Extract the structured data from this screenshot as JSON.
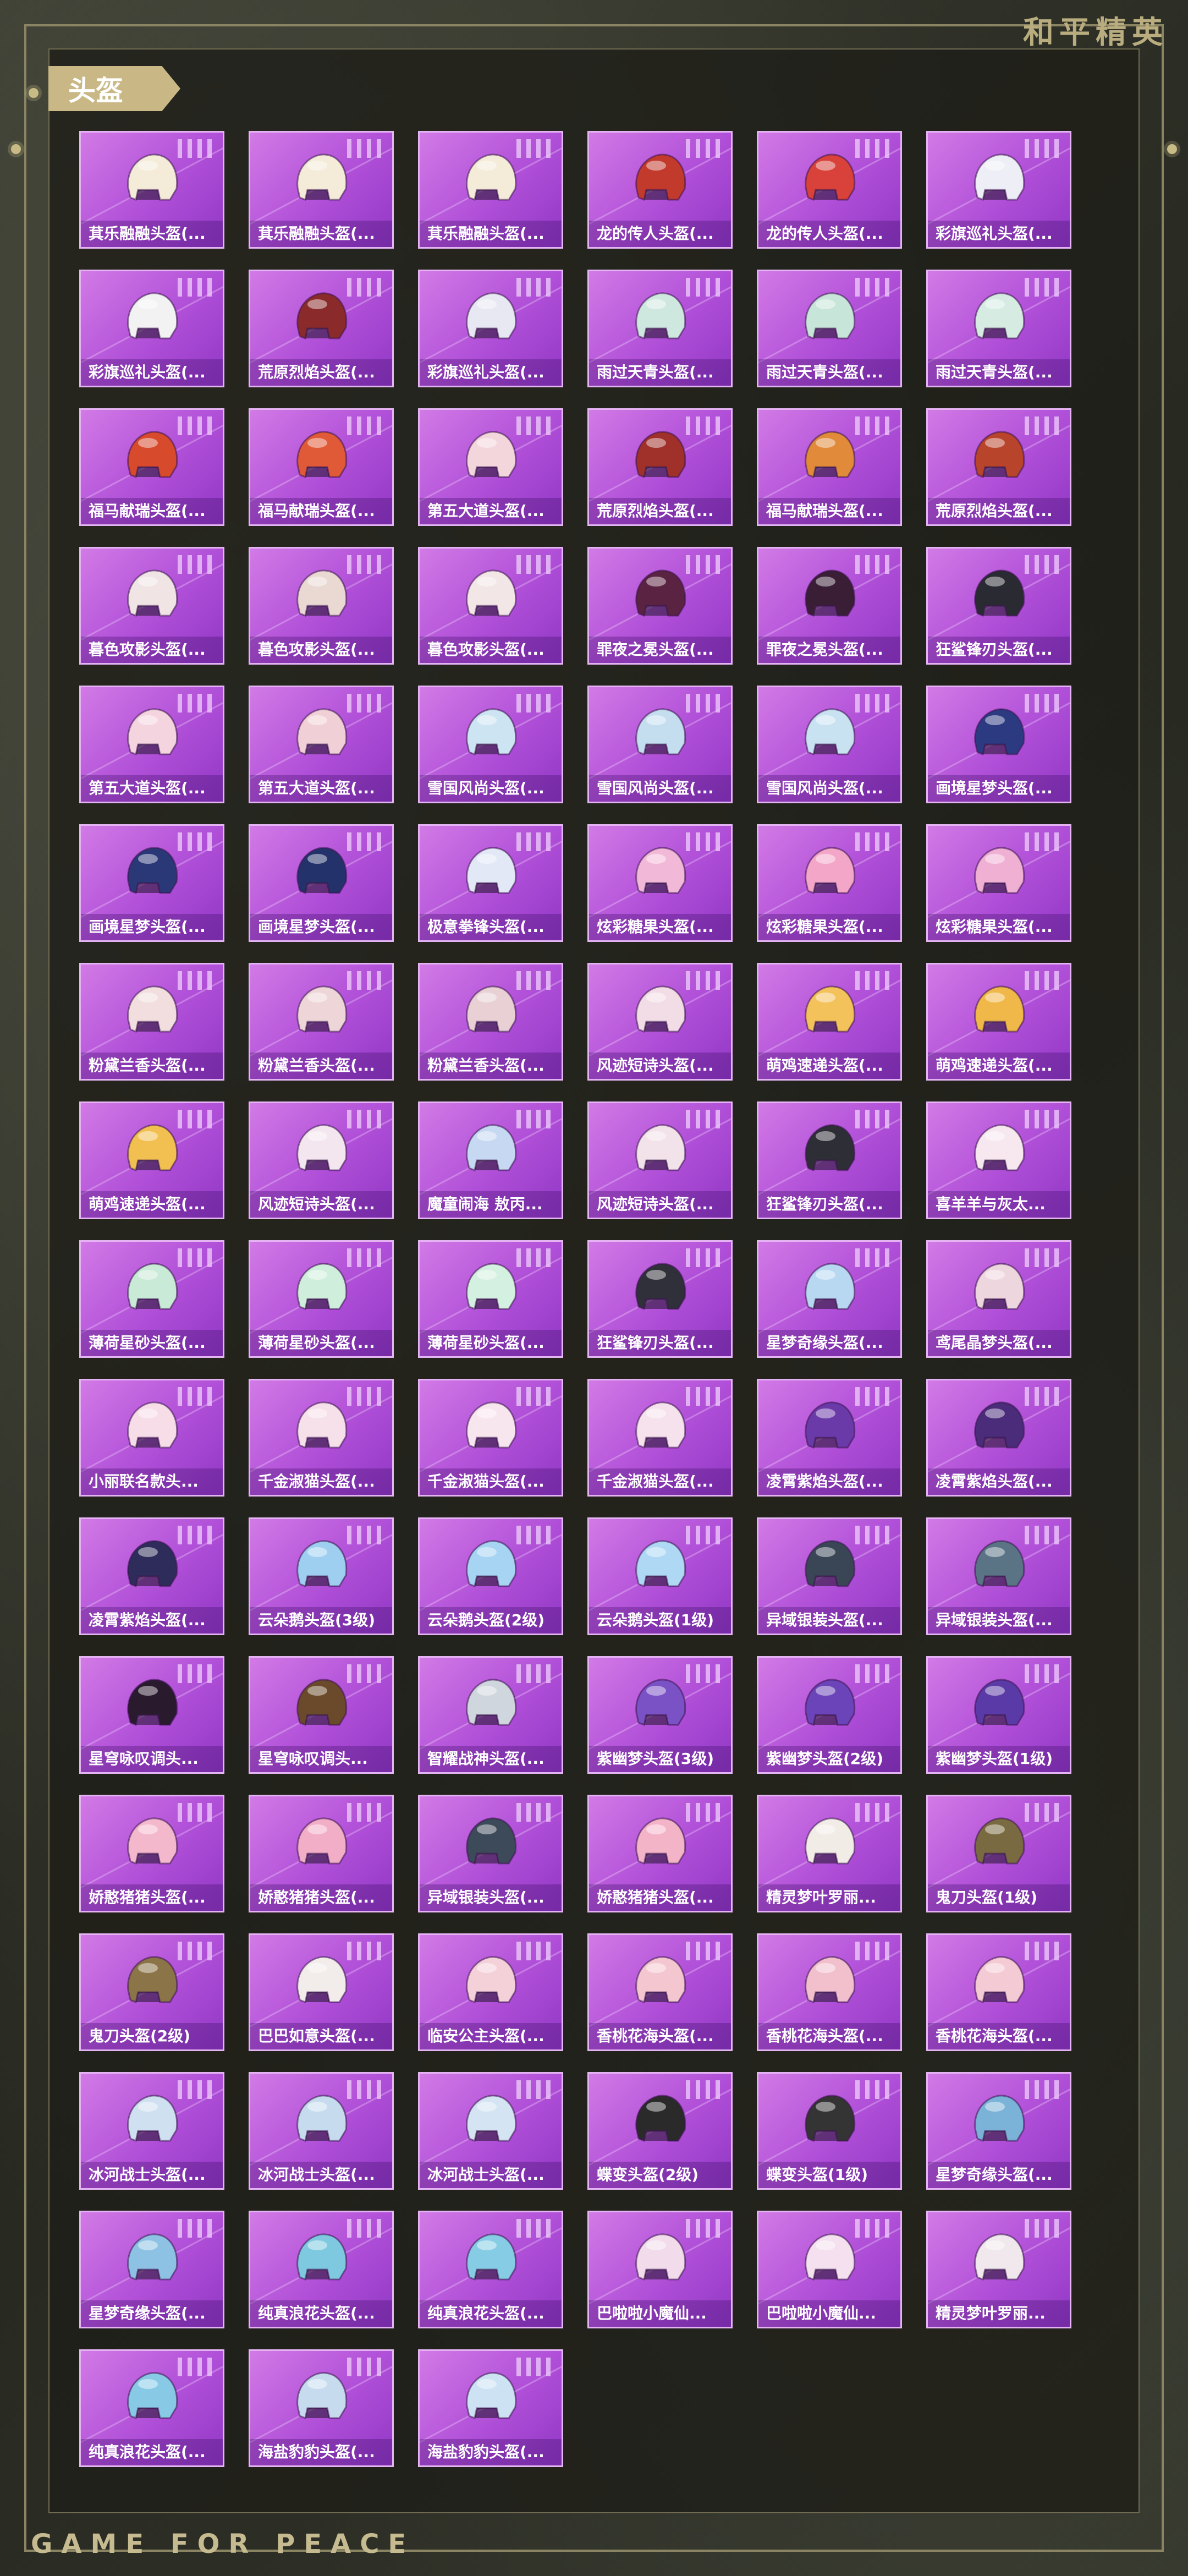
{
  "header": {
    "brand": "和平精英",
    "section_title": "头盔"
  },
  "footer": {
    "brand": "GAME FOR PEACE"
  },
  "items": [
    {
      "label": "萁乐融融头盔(...",
      "color": "#f4ecd8",
      "icon": "helmet-icon"
    },
    {
      "label": "萁乐融融头盔(...",
      "color": "#f4ecd8",
      "icon": "helmet-icon"
    },
    {
      "label": "萁乐融融头盔(...",
      "color": "#f4ecd8",
      "icon": "helmet-icon"
    },
    {
      "label": "龙的传人头盔(...",
      "color": "#c23a2c",
      "icon": "helmet-icon"
    },
    {
      "label": "龙的传人头盔(...",
      "color": "#d8423a",
      "icon": "helmet-icon"
    },
    {
      "label": "彩旗巡礼头盔(...",
      "color": "#eeeef6",
      "icon": "helmet-icon"
    },
    {
      "label": "彩旗巡礼头盔(...",
      "color": "#f2f2f2",
      "icon": "helmet-icon"
    },
    {
      "label": "荒原烈焰头盔(...",
      "color": "#8a2a2a",
      "icon": "helmet-icon"
    },
    {
      "label": "彩旗巡礼头盔(...",
      "color": "#e8e8f2",
      "icon": "helmet-icon"
    },
    {
      "label": "雨过天青头盔(...",
      "color": "#cfe8df",
      "icon": "helmet-icon"
    },
    {
      "label": "雨过天青头盔(...",
      "color": "#c7e5d8",
      "icon": "helmet-icon"
    },
    {
      "label": "雨过天青头盔(...",
      "color": "#d6ece3",
      "icon": "helmet-icon"
    },
    {
      "label": "福马献瑞头盔(...",
      "color": "#d84a2c",
      "icon": "helmet-icon"
    },
    {
      "label": "福马献瑞头盔(...",
      "color": "#e05a38",
      "icon": "helmet-icon"
    },
    {
      "label": "第五大道头盔(...",
      "color": "#f3d6dc",
      "icon": "helmet-icon"
    },
    {
      "label": "荒原烈焰头盔(...",
      "color": "#a0302a",
      "icon": "helmet-icon"
    },
    {
      "label": "福马献瑞头盔(...",
      "color": "#e08a3a",
      "icon": "helmet-icon"
    },
    {
      "label": "荒原烈焰头盔(...",
      "color": "#b8442c",
      "icon": "helmet-icon"
    },
    {
      "label": "暮色攻影头盔(...",
      "color": "#f0e4e4",
      "icon": "helmet-icon"
    },
    {
      "label": "暮色攻影头盔(...",
      "color": "#ead8d2",
      "icon": "helmet-icon"
    },
    {
      "label": "暮色攻影头盔(...",
      "color": "#f2e6e6",
      "icon": "helmet-icon"
    },
    {
      "label": "罪夜之冕头盔(...",
      "color": "#5a2342",
      "icon": "helmet-icon"
    },
    {
      "label": "罪夜之冕头盔(...",
      "color": "#3a1e36",
      "icon": "helmet-icon"
    },
    {
      "label": "狂鲨锋刃头盔(...",
      "color": "#2a2a32",
      "icon": "helmet-icon"
    },
    {
      "label": "第五大道头盔(...",
      "color": "#f4d4de",
      "icon": "helmet-icon"
    },
    {
      "label": "第五大道头盔(...",
      "color": "#f0d0d6",
      "icon": "helmet-icon"
    },
    {
      "label": "雪国风尚头盔(...",
      "color": "#cde4f2",
      "icon": "helmet-icon"
    },
    {
      "label": "雪国风尚头盔(...",
      "color": "#c4def0",
      "icon": "helmet-icon"
    },
    {
      "label": "雪国风尚头盔(...",
      "color": "#c8e2f2",
      "icon": "helmet-icon"
    },
    {
      "label": "画境星梦头盔(...",
      "color": "#2c3a82",
      "icon": "helmet-icon"
    },
    {
      "label": "画境星梦头盔(...",
      "color": "#2a3878",
      "icon": "helmet-icon"
    },
    {
      "label": "画境星梦头盔(...",
      "color": "#24326c",
      "icon": "helmet-icon"
    },
    {
      "label": "极意拳锋头盔(...",
      "color": "#e2e8f6",
      "icon": "helmet-icon"
    },
    {
      "label": "炫彩糖果头盔(...",
      "color": "#f2b8d8",
      "icon": "helmet-icon"
    },
    {
      "label": "炫彩糖果头盔(...",
      "color": "#f4a6c8",
      "icon": "helmet-icon"
    },
    {
      "label": "炫彩糖果头盔(...",
      "color": "#f0b0d4",
      "icon": "helmet-icon"
    },
    {
      "label": "粉黛兰香头盔(...",
      "color": "#f2dede",
      "icon": "helmet-icon"
    },
    {
      "label": "粉黛兰香头盔(...",
      "color": "#eed6d8",
      "icon": "helmet-icon"
    },
    {
      "label": "粉黛兰香头盔(...",
      "color": "#e8d0d4",
      "icon": "helmet-icon"
    },
    {
      "label": "风迹短诗头盔(...",
      "color": "#f2dce6",
      "icon": "helmet-icon"
    },
    {
      "label": "萌鸡速递头盔(...",
      "color": "#f4c25a",
      "icon": "helmet-icon"
    },
    {
      "label": "萌鸡速递头盔(...",
      "color": "#f0b848",
      "icon": "helmet-icon"
    },
    {
      "label": "萌鸡速递头盔(...",
      "color": "#f2c050",
      "icon": "helmet-icon"
    },
    {
      "label": "风迹短诗头盔(...",
      "color": "#f4e6ee",
      "icon": "helmet-icon"
    },
    {
      "label": "魔童闹海 敖丙...",
      "color": "#c6d8f2",
      "icon": "helmet-icon"
    },
    {
      "label": "风迹短诗头盔(...",
      "color": "#f2e2ea",
      "icon": "helmet-icon"
    },
    {
      "label": "狂鲨锋刃头盔(...",
      "color": "#2e2e36",
      "icon": "helmet-icon"
    },
    {
      "label": "喜羊羊与灰太...",
      "color": "#f6e8ee",
      "icon": "helmet-icon"
    },
    {
      "label": "薄荷星砂头盔(...",
      "color": "#c8ead6",
      "icon": "helmet-icon"
    },
    {
      "label": "薄荷星砂头盔(...",
      "color": "#d0eedc",
      "icon": "helmet-icon"
    },
    {
      "label": "薄荷星砂头盔(...",
      "color": "#d4f0e0",
      "icon": "helmet-icon"
    },
    {
      "label": "狂鲨锋刃头盔(...",
      "color": "#30303a",
      "icon": "helmet-icon"
    },
    {
      "label": "星梦奇缘头盔(...",
      "color": "#b8d8f2",
      "icon": "helmet-icon"
    },
    {
      "label": "鸢尾晶梦头盔(...",
      "color": "#eed6de",
      "icon": "helmet-icon"
    },
    {
      "label": "小丽联名款头...",
      "color": "#f6dde8",
      "icon": "helmet-icon"
    },
    {
      "label": "千金淑猫头盔(...",
      "color": "#f6e0ea",
      "icon": "helmet-icon"
    },
    {
      "label": "千金淑猫头盔(...",
      "color": "#f8e6ee",
      "icon": "helmet-icon"
    },
    {
      "label": "千金淑猫头盔(...",
      "color": "#f6e2ec",
      "icon": "helmet-icon"
    },
    {
      "label": "凌霄紫焰头盔(...",
      "color": "#6a3aa8",
      "icon": "helmet-icon"
    },
    {
      "label": "凌霄紫焰头盔(...",
      "color": "#4a2c7a",
      "icon": "helmet-icon"
    },
    {
      "label": "凌霄紫焰头盔(...",
      "color": "#2e2c5a",
      "icon": "helmet-icon"
    },
    {
      "label": "云朵鹅头盔(3级)",
      "color": "#9ecff0",
      "icon": "helmet-icon"
    },
    {
      "label": "云朵鹅头盔(2级)",
      "color": "#a6d4f2",
      "icon": "helmet-icon"
    },
    {
      "label": "云朵鹅头盔(1级)",
      "color": "#aed8f4",
      "icon": "helmet-icon"
    },
    {
      "label": "异域银装头盔(...",
      "color": "#3a4656",
      "icon": "helmet-icon"
    },
    {
      "label": "异域银装头盔(...",
      "color": "#5a7486",
      "icon": "helmet-icon"
    },
    {
      "label": "星穹咏叹调头...",
      "color": "#2a1a2e",
      "icon": "helmet-icon"
    },
    {
      "label": "星穹咏叹调头...",
      "color": "#6a4a2a",
      "icon": "helmet-icon"
    },
    {
      "label": "智耀战神头盔(...",
      "color": "#cfd6de",
      "icon": "helmet-icon"
    },
    {
      "label": "紫幽梦头盔(3级)",
      "color": "#7a52c6",
      "icon": "helmet-icon"
    },
    {
      "label": "紫幽梦头盔(2级)",
      "color": "#6a44b8",
      "icon": "helmet-icon"
    },
    {
      "label": "紫幽梦头盔(1级)",
      "color": "#5a3aa6",
      "icon": "helmet-icon"
    },
    {
      "label": "娇憨猪猪头盔(...",
      "color": "#f4b8cc",
      "icon": "helmet-icon"
    },
    {
      "label": "娇憨猪猪头盔(...",
      "color": "#f2aec6",
      "icon": "helmet-icon"
    },
    {
      "label": "异域银装头盔(...",
      "color": "#3c4a5a",
      "icon": "helmet-icon"
    },
    {
      "label": "娇憨猪猪头盔(...",
      "color": "#f4b4c8",
      "icon": "helmet-icon"
    },
    {
      "label": "精灵梦叶罗丽...",
      "color": "#f2ece6",
      "icon": "helmet-icon"
    },
    {
      "label": "鬼刀头盔(1级)",
      "color": "#7a6a42",
      "icon": "helmet-icon"
    },
    {
      "label": "鬼刀头盔(2级)",
      "color": "#8a7448",
      "icon": "helmet-icon"
    },
    {
      "label": "巴巴如意头盔(...",
      "color": "#f2ecea",
      "icon": "helmet-icon"
    },
    {
      "label": "临安公主头盔(...",
      "color": "#f4d0d8",
      "icon": "helmet-icon"
    },
    {
      "label": "香桃花海头盔(...",
      "color": "#f4c6d0",
      "icon": "helmet-icon"
    },
    {
      "label": "香桃花海头盔(...",
      "color": "#f2c0cc",
      "icon": "helmet-icon"
    },
    {
      "label": "香桃花海头盔(...",
      "color": "#f4cad4",
      "icon": "helmet-icon"
    },
    {
      "label": "冰河战士头盔(...",
      "color": "#cfe0f0",
      "icon": "helmet-icon"
    },
    {
      "label": "冰河战士头盔(...",
      "color": "#c6dcee",
      "icon": "helmet-icon"
    },
    {
      "label": "冰河战士头盔(...",
      "color": "#d4e4f2",
      "icon": "helmet-icon"
    },
    {
      "label": "蝶变头盔(2级)",
      "color": "#2a2a2a",
      "icon": "helmet-icon"
    },
    {
      "label": "蝶变头盔(1级)",
      "color": "#343434",
      "icon": "helmet-icon"
    },
    {
      "label": "星梦奇缘头盔(...",
      "color": "#7ab2d8",
      "icon": "helmet-icon"
    },
    {
      "label": "星梦奇缘头盔(...",
      "color": "#8ec2e4",
      "icon": "helmet-icon"
    },
    {
      "label": "纯真浪花头盔(...",
      "color": "#7ec8e0",
      "icon": "helmet-icon"
    },
    {
      "label": "纯真浪花头盔(...",
      "color": "#86cce4",
      "icon": "helmet-icon"
    },
    {
      "label": "巴啦啦小魔仙...",
      "color": "#f2dcec",
      "icon": "helmet-icon"
    },
    {
      "label": "巴啦啦小魔仙...",
      "color": "#f4e0ee",
      "icon": "helmet-icon"
    },
    {
      "label": "精灵梦叶罗丽...",
      "color": "#f0e8ec",
      "icon": "helmet-icon"
    },
    {
      "label": "纯真浪花头盔(...",
      "color": "#88cae6",
      "icon": "helmet-icon"
    },
    {
      "label": "海盐豹豹头盔(...",
      "color": "#c6dcee",
      "icon": "helmet-icon"
    },
    {
      "label": "海盐豹豹头盔(...",
      "color": "#cde2f2",
      "icon": "helmet-icon"
    }
  ]
}
